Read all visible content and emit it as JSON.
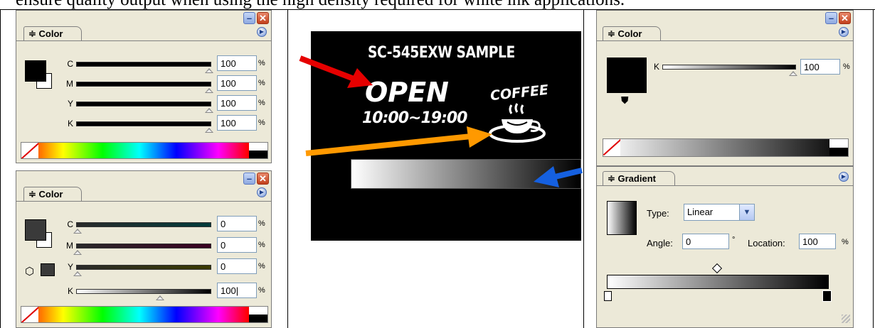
{
  "caption": "ensure quality output when using the high density required for white ink applications.",
  "panel_color_cmyk": {
    "tab_label": "≑ Color",
    "channels": [
      {
        "label": "C",
        "value": "100",
        "unit": "%"
      },
      {
        "label": "M",
        "value": "100",
        "unit": "%"
      },
      {
        "label": "Y",
        "value": "100",
        "unit": "%"
      },
      {
        "label": "K",
        "value": "100",
        "unit": "%"
      }
    ]
  },
  "panel_color_k": {
    "tab_label": "≑ Color",
    "channels": [
      {
        "label": "C",
        "value": "0",
        "unit": "%"
      },
      {
        "label": "M",
        "value": "0",
        "unit": "%"
      },
      {
        "label": "Y",
        "value": "0",
        "unit": "%"
      },
      {
        "label": "K",
        "value": "100|",
        "unit": "%"
      }
    ]
  },
  "sample": {
    "title": "SC-545EXW SAMPLE",
    "open_text": "OPEN",
    "hours": "10:00~19:00",
    "coffee": "COFFEE",
    "colors": {
      "arrow_red": "#e60000",
      "arrow_orange": "#ff9900",
      "arrow_blue": "#1560e0"
    }
  },
  "panel_color_gray": {
    "tab_label": "≑ Color",
    "channels": [
      {
        "label": "K",
        "value": "100",
        "unit": "%"
      }
    ]
  },
  "panel_gradient": {
    "tab_label": "≑ Gradient",
    "type_label": "Type:",
    "type_value": "Linear",
    "angle_label": "Angle:",
    "angle_value": "0",
    "angle_unit": "°",
    "location_label": "Location:",
    "location_value": "100",
    "location_unit": "%"
  },
  "icons": {
    "minimize": "minimize-icon",
    "close": "close-icon",
    "panel_menu": "play-menu-icon"
  }
}
